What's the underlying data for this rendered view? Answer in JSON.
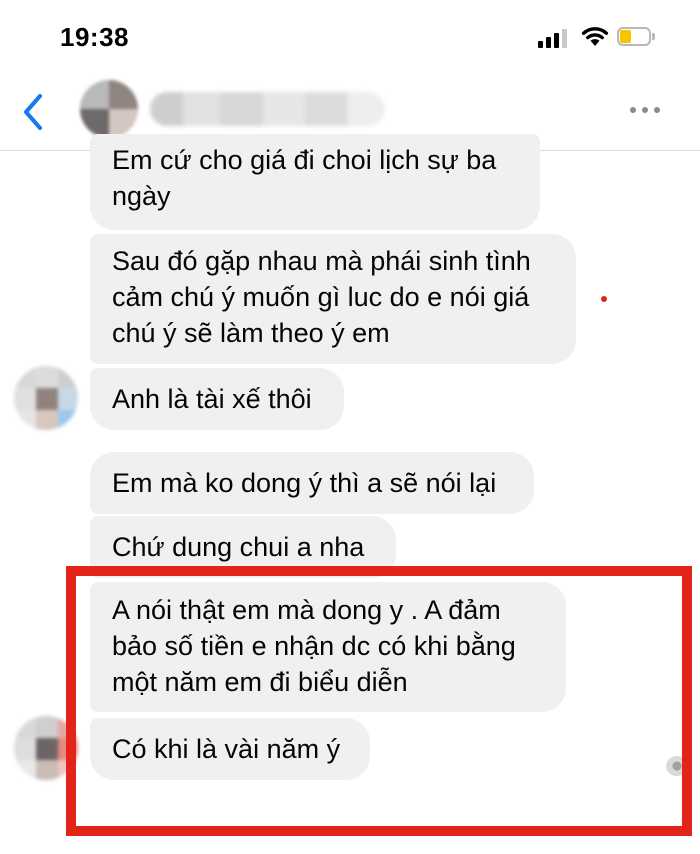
{
  "status_bar": {
    "time": "19:38",
    "icons": [
      "cellular-signal-icon",
      "wifi-icon",
      "battery-icon"
    ],
    "battery_color": "#f7c600"
  },
  "header": {
    "icons": [
      "back-chevron-icon",
      "more-options-icon"
    ],
    "accent_color": "#1877f2"
  },
  "messages": [
    {
      "sender": "contact",
      "lines": [
        "Em cứ cho giá đi choi lịch sự ba",
        "ngày"
      ]
    },
    {
      "sender": "contact",
      "lines": [
        "Sau đó gặp nhau mà phái sinh tình",
        "cảm chú ý muốn gì luc do e nói giá",
        "chú ý sẽ làm theo ý em"
      ]
    },
    {
      "sender": "contact",
      "lines": [
        "Anh là tài xế thôi"
      ]
    },
    {
      "sender": "contact",
      "lines": [
        "Em mà ko dong ý thì a sẽ nói lại"
      ]
    },
    {
      "sender": "contact",
      "lines": [
        "Chứ dung chui a nha"
      ]
    },
    {
      "sender": "contact",
      "lines": [
        "A nói thật em mà dong y . A đảm",
        "bảo số tiền e nhận dc có khi bằng",
        "một năm em đi biểu diễn"
      ]
    },
    {
      "sender": "contact",
      "lines": [
        "Có khi là vài năm ý"
      ]
    }
  ],
  "highlight": {
    "color": "#e3241b"
  }
}
